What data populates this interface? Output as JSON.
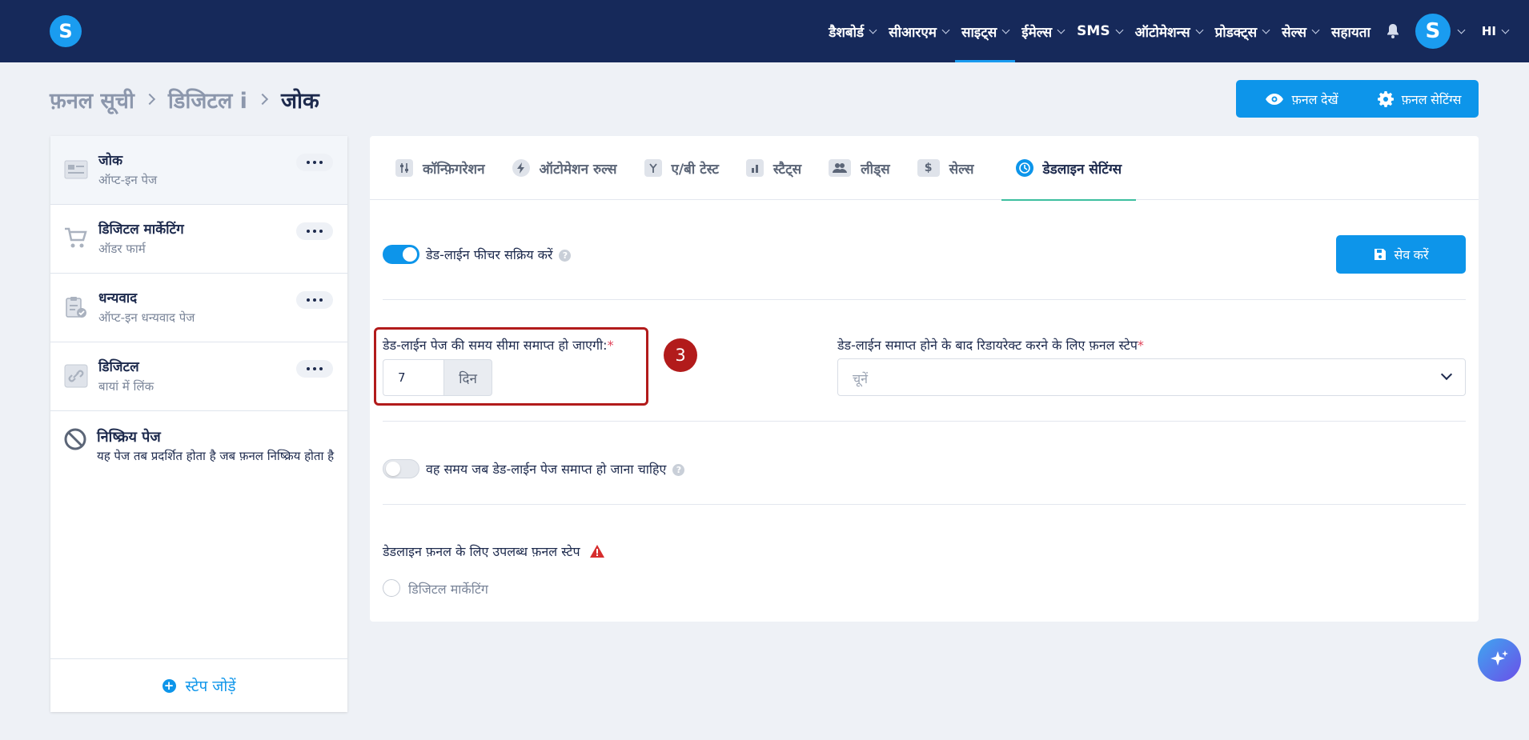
{
  "app": {
    "logo_letter": "S"
  },
  "nav": {
    "items": [
      {
        "label": "डैशबोर्ड"
      },
      {
        "label": "सीआरएम"
      },
      {
        "label": "साइट्स"
      },
      {
        "label": "ईमेल्स"
      },
      {
        "label": "SMS"
      },
      {
        "label": "ऑटोमेशन्स"
      },
      {
        "label": "प्रोडक्ट्स"
      },
      {
        "label": "सेल्स"
      }
    ],
    "help_label": "सहायता",
    "avatar_letter": "S",
    "language": "HI"
  },
  "breadcrumb": {
    "items": [
      "फ़नल सूची",
      "डिजिटल i"
    ],
    "current": "जोक"
  },
  "header_actions": {
    "view_funnel": "फ़नल देखें",
    "funnel_settings": "फ़नल सेटिंग्स"
  },
  "sidebar": {
    "steps": [
      {
        "title": "जोक",
        "subtitle": "ऑप्ट-इन पेज"
      },
      {
        "title": "डिजिटल मार्केटिंग",
        "subtitle": "ऑडर फार्म"
      },
      {
        "title": "धन्यवाद",
        "subtitle": "ऑप्ट-इन धन्यवाद पेज"
      },
      {
        "title": "डिजिटल",
        "subtitle": "बायां में लिंक"
      }
    ],
    "inactive": {
      "title": "निष्क्रिय पेज",
      "description": "यह पेज तब प्रदर्शित होता है जब फ़नल निष्क्रिय होता है"
    },
    "add_step": "स्टेप जोड़ें"
  },
  "tabs": [
    {
      "label": "कॉन्फ़िगरेशन",
      "icon": "sliders-icon"
    },
    {
      "label": "ऑटोमेशन रुल्स",
      "icon": "bolt-icon"
    },
    {
      "label": "ए/बी टेस्ट",
      "icon": "split-icon"
    },
    {
      "label": "स्टैट्स",
      "icon": "bar-chart-icon"
    },
    {
      "label": "लीड्स",
      "icon": "users-icon"
    },
    {
      "label": "सेल्स",
      "icon": "dollar-icon"
    },
    {
      "label": "डेडलाइन सेटिंग्स",
      "icon": "clock-icon",
      "active": true
    }
  ],
  "deadline": {
    "enable_label": "डेड-लाईन फीचर सक्रिय करें",
    "enable_on": true,
    "save_label": "सेव करें",
    "expire_label": "डेड-लाईन पेज की समय सीमा समाप्त हो जाएगी:",
    "expire_value": "7",
    "expire_unit": "दिन",
    "step_badge": "3",
    "redirect_label": "डेड-लाईन समाप्त होने के बाद रिडायरेक्ट करने के लिए फ़नल स्टेप",
    "redirect_placeholder": "चूनें",
    "time_label": "वह समय जब डेड-लाईन पेज समाप्त हो जाना चाहिए",
    "time_on": false,
    "available_label": "डेडलाइन फ़नल के लिए उपलब्ध फ़नल स्टेप",
    "available_steps": [
      "डिजिटल मार्केटिंग"
    ]
  },
  "colors": {
    "navbar": "#16295a",
    "accent": "#0d95ea",
    "highlight": "#b21b1b",
    "warning": "#d62d2d"
  }
}
